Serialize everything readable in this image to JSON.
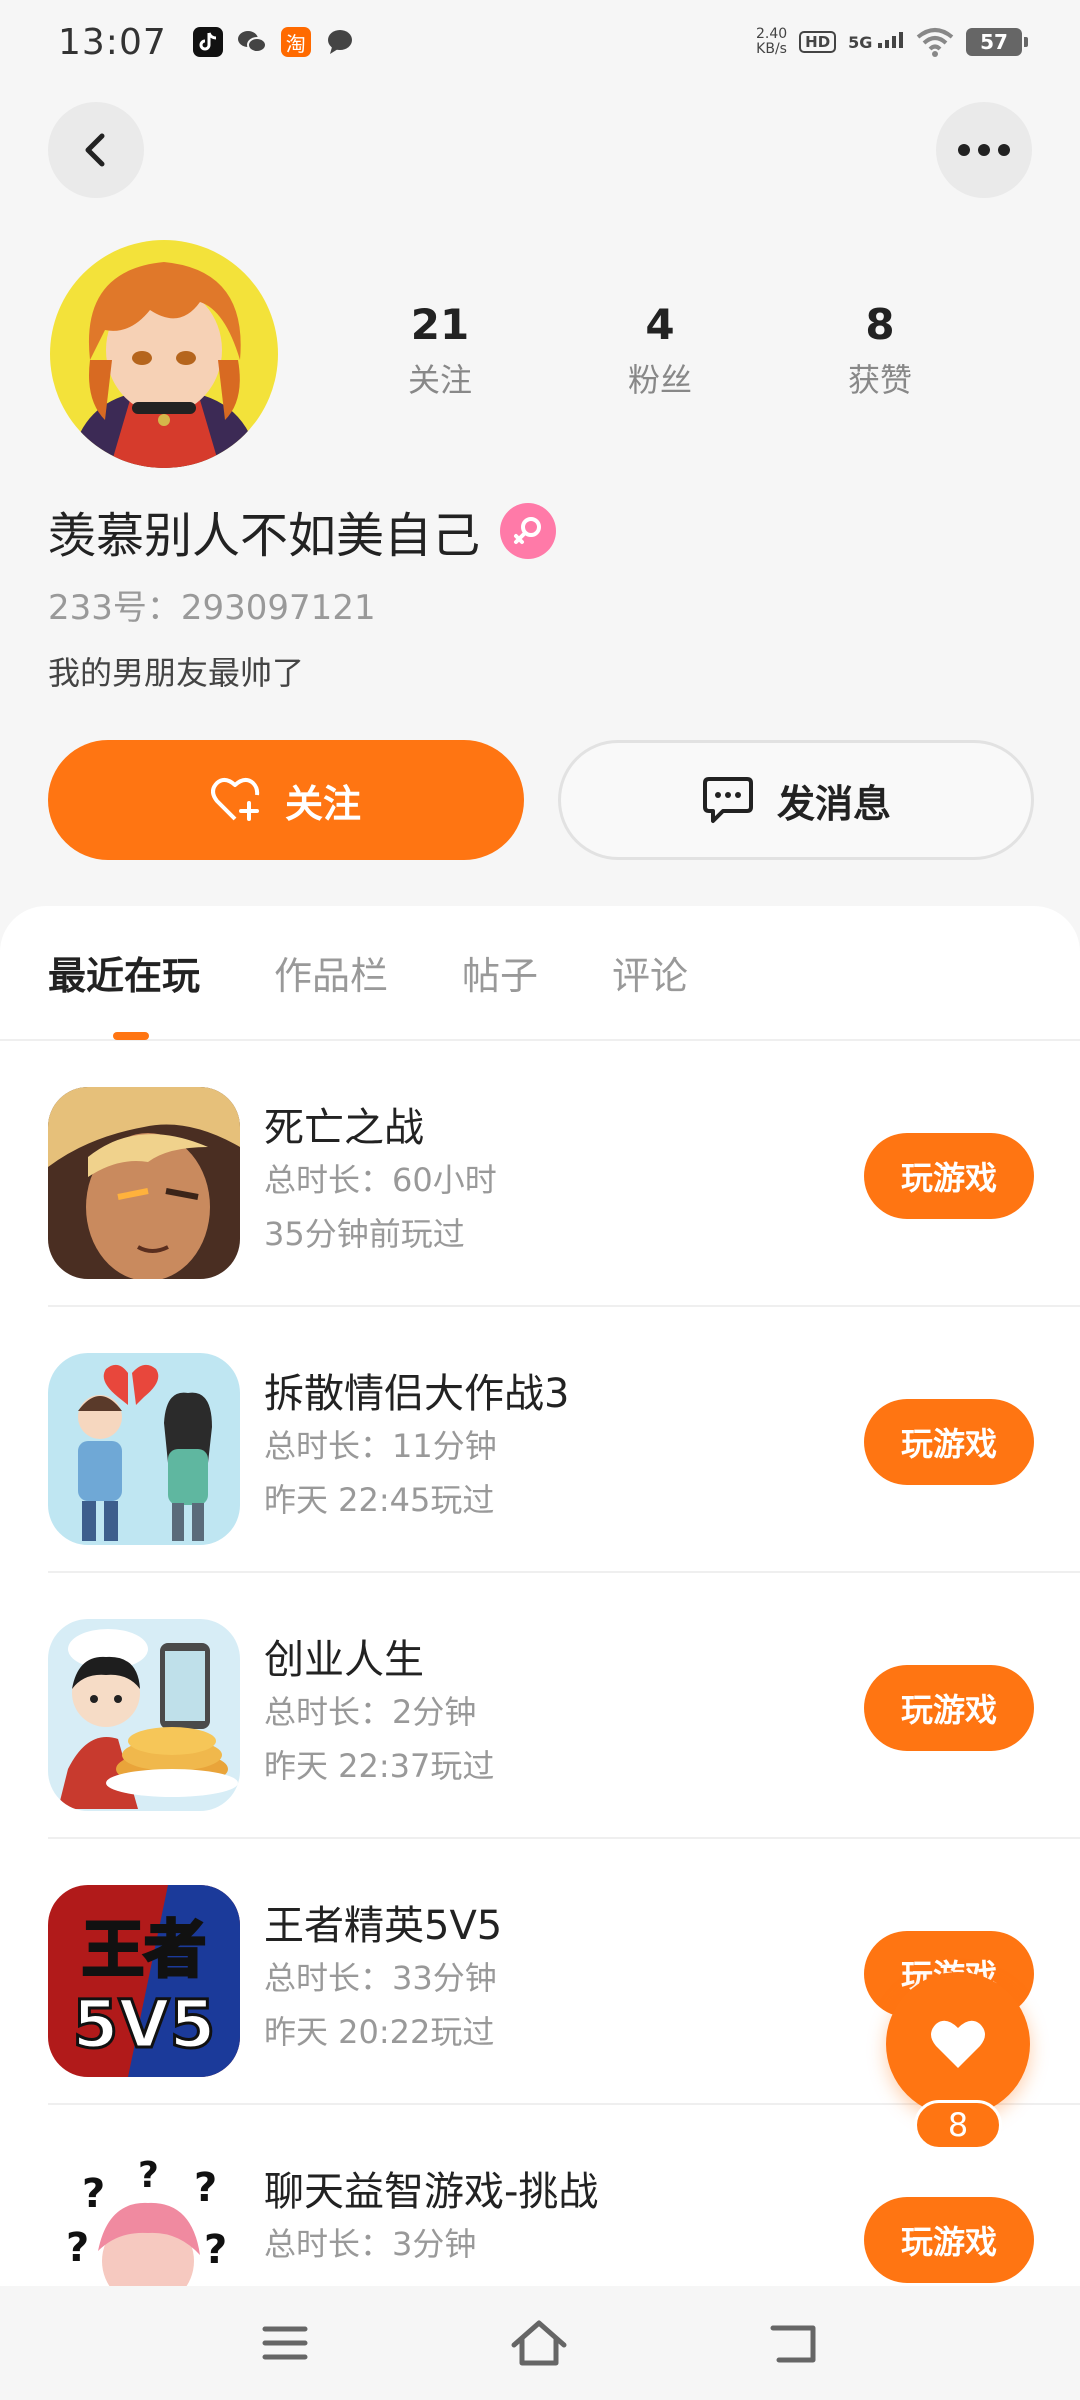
{
  "status_bar": {
    "time": "13:07",
    "net_speed_value": "2.40",
    "net_speed_unit": "KB/s",
    "hd": "HD",
    "signal": "5G",
    "battery": "57",
    "notifications": [
      "tiktok-icon",
      "wechat-icon",
      "taobao-icon",
      "message-icon"
    ],
    "taobao_label": "淘"
  },
  "profile": {
    "following_count": "21",
    "following_label": "关注",
    "followers_count": "4",
    "followers_label": "粉丝",
    "likes_count": "8",
    "likes_label": "获赞",
    "nickname": "羡慕别人不如美自己",
    "gender": "female",
    "uid": "233号：293097121",
    "bio": "我的男朋友最帅了"
  },
  "actions": {
    "follow_label": "关注",
    "message_label": "发消息"
  },
  "tabs": [
    {
      "label": "最近在玩",
      "active": true
    },
    {
      "label": "作品栏",
      "active": false
    },
    {
      "label": "帖子",
      "active": false
    },
    {
      "label": "评论",
      "active": false
    }
  ],
  "games": [
    {
      "name": "死亡之战",
      "duration": "总时长：60小时",
      "last_played": "35分钟前玩过",
      "button": "玩游戏"
    },
    {
      "name": "拆散情侣大作战3",
      "duration": "总时长：11分钟",
      "last_played": "昨天 22:45玩过",
      "button": "玩游戏"
    },
    {
      "name": "创业人生",
      "duration": "总时长：2分钟",
      "last_played": "昨天 22:37玩过",
      "button": "玩游戏"
    },
    {
      "name": "王者精英5V5",
      "duration": "总时长：33分钟",
      "last_played": "昨天 20:22玩过",
      "button": "玩游戏",
      "icon_text_top": "王者",
      "icon_text_bottom": "5V5"
    },
    {
      "name": "聊天益智游戏-挑战",
      "duration": "总时长：3分钟",
      "last_played": "",
      "button": "玩游戏"
    }
  ],
  "floating_like": {
    "count": "8"
  },
  "colors": {
    "accent": "#ff7512",
    "gender_pink": "#ff7aa8",
    "background": "#f6f6f6"
  }
}
